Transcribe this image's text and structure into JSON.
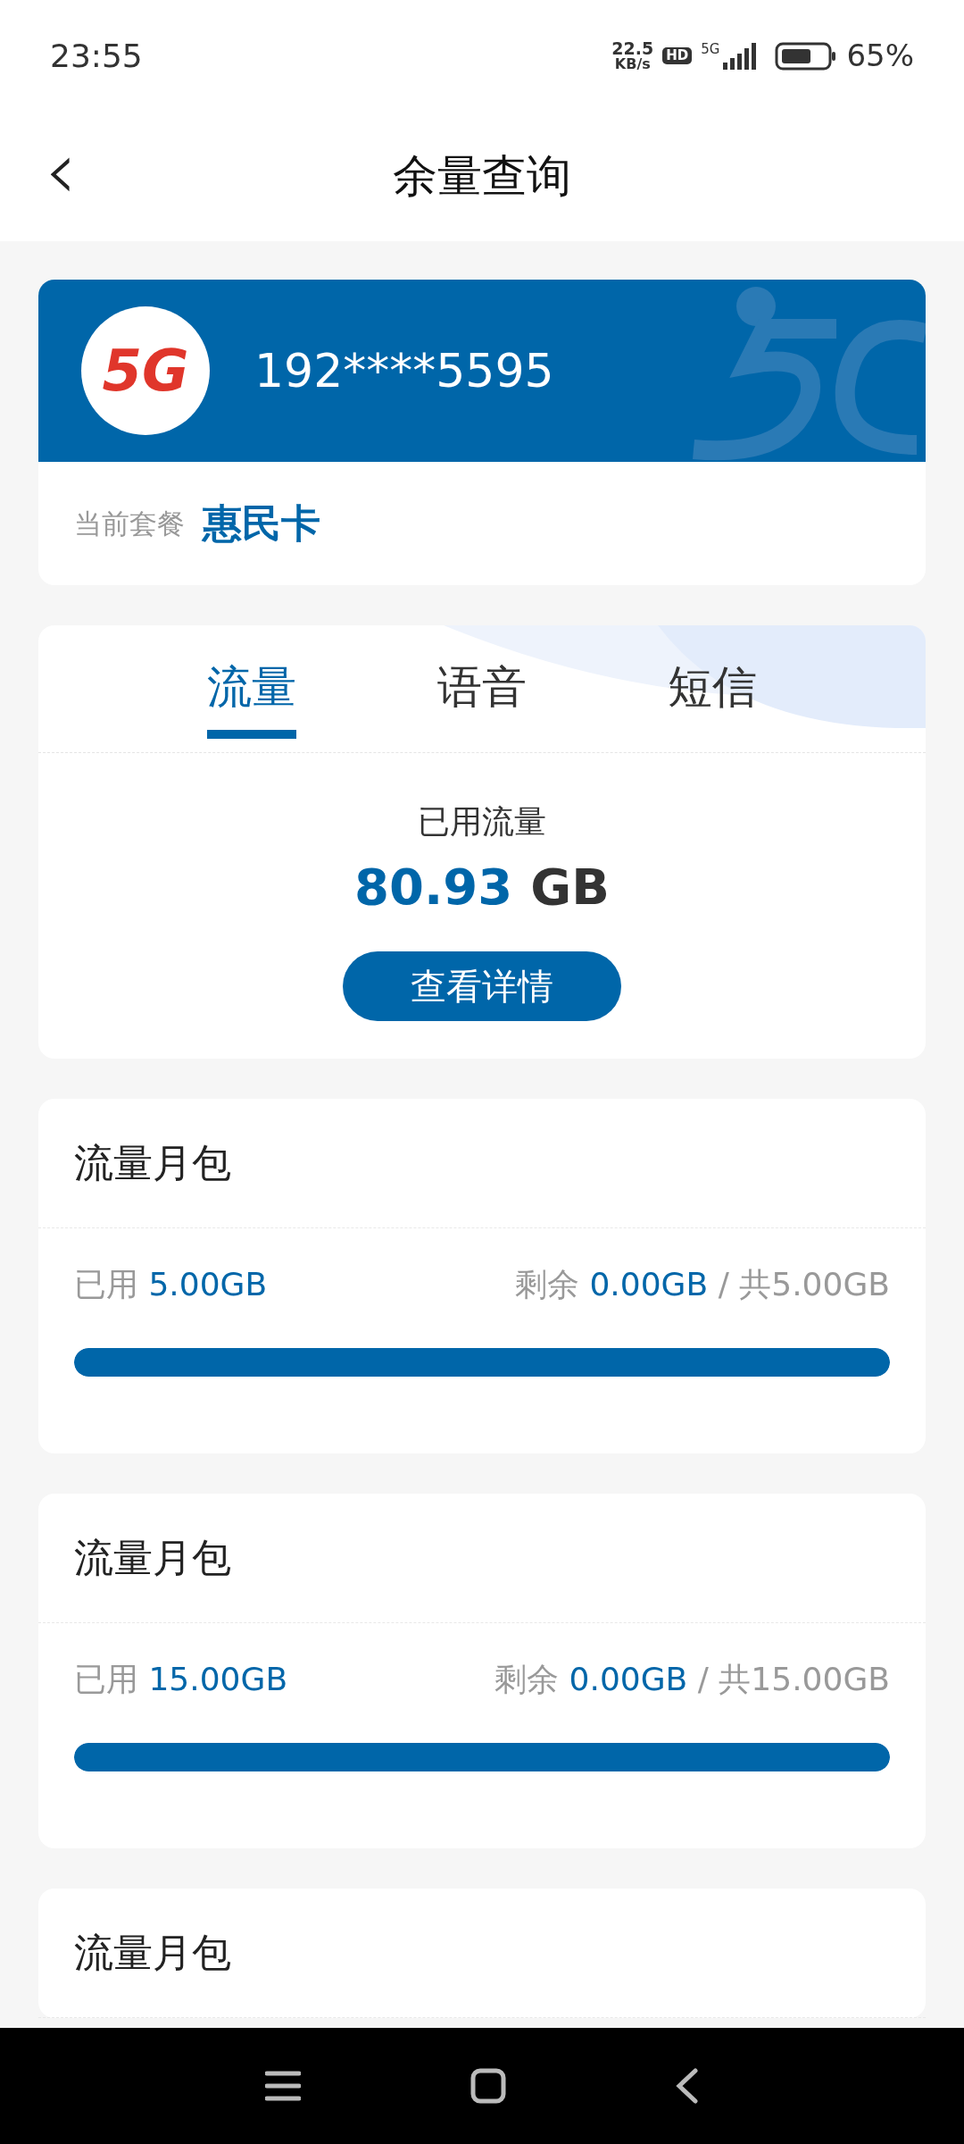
{
  "status_bar": {
    "time": "23:55",
    "net_speed": "22.5",
    "net_unit": "KB/s",
    "hd": "HD",
    "network": "5G",
    "battery": "65%"
  },
  "header": {
    "back": "‹",
    "title": "余量查询"
  },
  "account": {
    "logo": "5G",
    "phone": "192****5595",
    "plan_label": "当前套餐",
    "plan_name": "惠民卡"
  },
  "tabs": [
    {
      "label": "流量",
      "selected": true
    },
    {
      "label": "语音",
      "selected": false
    },
    {
      "label": "短信",
      "selected": false
    }
  ],
  "usage": {
    "label": "已用流量",
    "value": "80.93",
    "unit": "GB",
    "button": "查看详情"
  },
  "packages": [
    {
      "title": "流量月包",
      "used_label": "已用",
      "used_value": "5.00GB",
      "remaining_label": "剩余",
      "remaining_value": "0.00GB",
      "separator": "/",
      "total": "共5.00GB",
      "level": 1
    },
    {
      "title": "流量月包",
      "used_label": "已用",
      "used_value": "15.00GB",
      "remaining_label": "剩余",
      "remaining_value": "0.00GB",
      "separator": "/",
      "total": "共15.00GB",
      "level": 1
    },
    {
      "title": "流量月包"
    }
  ]
}
